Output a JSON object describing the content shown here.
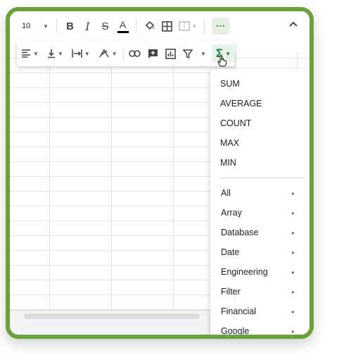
{
  "toolbar": {
    "font_size": "10",
    "bold_label": "B",
    "italic_label": "I",
    "strike_label": "S",
    "text_color_label": "A",
    "more_label": "⋯",
    "collapse_icon": "chevron-up-icon",
    "sigma_label": "Σ"
  },
  "function_menu": {
    "quick": [
      "SUM",
      "AVERAGE",
      "COUNT",
      "MAX",
      "MIN"
    ],
    "categories": [
      "All",
      "Array",
      "Database",
      "Date",
      "Engineering",
      "Filter",
      "Financial",
      "Google"
    ],
    "submenu_arrow": "▸"
  },
  "colors": {
    "frame": "#6aa13a",
    "sigma_bg": "#e6f4ea",
    "sigma_fg": "#188038"
  }
}
